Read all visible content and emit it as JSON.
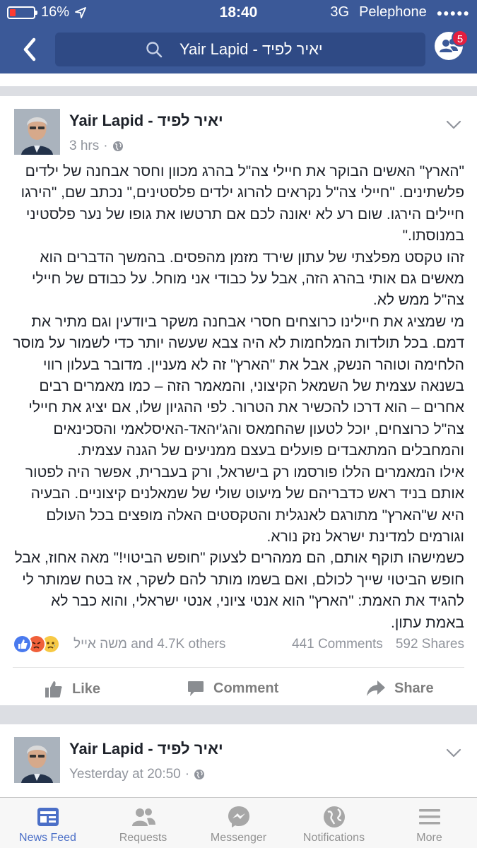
{
  "status_bar": {
    "battery": "16%",
    "time": "18:40",
    "network": "3G",
    "carrier": "Pelephone",
    "signal_dots": "●●●●●"
  },
  "nav": {
    "search_text": "Yair Lapid - יאיר לפיד",
    "friend_requests_badge": "5"
  },
  "posts": [
    {
      "author": "Yair Lapid - יאיר לפיד",
      "time": "3 hrs",
      "paragraphs": [
        "\"הארץ\" האשים הבוקר את חיילי צה\"ל בהרג מכוון וחסר אבחנה של ילדים פלשתינים. \"חיילי צה\"ל נקראים להרוג ילדים פלסטינים,\" נכתב שם, \"הירגו חיילים הירגו. שום רע לא יאונה לכם אם תרטשו את גופו של נער פלסטיני במנוסתו.\"",
        "זהו טקסט מפלצתי של עתון שירד מזמן מהפסים. בהמשך הדברים הוא מאשים גם אותי בהרג הזה, אבל על כבודי אני מוחל. על כבודם של חיילי צה\"ל ממש לא.",
        "מי שמציג את חיילינו כרוצחים חסרי אבחנה משקר ביודעין וגם מתיר את דמם. בכל תולדות המלחמות לא היה צבא שעשה יותר כדי לשמור על מוסר הלחימה וטוהר הנשק, אבל את \"הארץ\" זה לא מעניין. מדובר בעלון רווי בשנאה עצמית של השמאל הקיצוני, והמאמר הזה – כמו מאמרים רבים אחרים – הוא דרכו להכשיר את הטרור. לפי ההגיון שלו, אם יציג את חיילי צה\"ל כרוצחים, יוכל לטעון שהחמאס והג'יהאד-האיסלאמי והסכינאים והמחבלים המתאבדים פועלים בעצם ממניעים של הגנה עצמית.",
        "אילו המאמרים הללו פורסמו רק בישראל, ורק בעברית, אפשר היה לפטור אותם בניד ראש כדבריהם של מיעוט שולי של שמאלנים קיצוניים. הבעיה היא ש\"הארץ\" מתורגם לאנגלית והטקסטים האלה מופצים בכל העולם וגורמים למדינת ישראל נזק נורא.",
        "כשמישהו תוקף אותם, הם ממהרים לצעוק \"חופש הביטוי!\" מאה אחוז, אבל חופש הביטוי שייך לכולם, ואם בשמו מותר להם לשקר, אז בטח שמותר לי להגיד את האמת: \"הארץ\" הוא אנטי ציוני, אנטי ישראלי, והוא כבר לא באמת עתון."
      ],
      "reactions_text": "משה אייל and 4.7K others",
      "comments": "441 Comments",
      "shares": "592 Shares"
    },
    {
      "author": "Yair Lapid - יאיר לפיד",
      "time": "Yesterday at 20:50"
    }
  ],
  "actions": {
    "like": "Like",
    "comment": "Comment",
    "share": "Share"
  },
  "tabs": [
    {
      "label": "News Feed",
      "icon": "news-feed-icon"
    },
    {
      "label": "Requests",
      "icon": "requests-icon"
    },
    {
      "label": "Messenger",
      "icon": "messenger-icon"
    },
    {
      "label": "Notifications",
      "icon": "globe-icon"
    },
    {
      "label": "More",
      "icon": "menu-icon"
    }
  ],
  "colors": {
    "brand": "#3b5998",
    "active_tab": "#4b6fc7",
    "badge": "#e41e3f"
  }
}
